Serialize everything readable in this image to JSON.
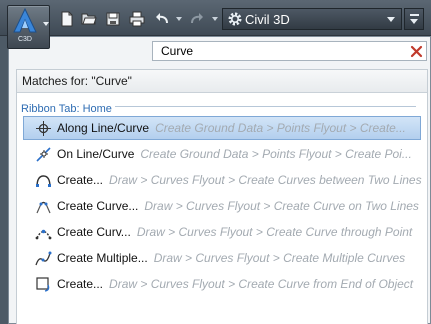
{
  "app": {
    "label": "C3D"
  },
  "workspace": {
    "label": "Civil 3D"
  },
  "search": {
    "value": "Curve"
  },
  "results": {
    "header": "Matches for: \"Curve\"",
    "group_label": "Ribbon Tab: Home",
    "items": [
      {
        "name": "Along Line/Curve",
        "path": "Create Ground Data > Points Flyout > Create...",
        "icon": "point-along-curve-icon",
        "selected": true
      },
      {
        "name": "On Line/Curve",
        "path": "Create Ground Data > Points Flyout > Create Poi...",
        "icon": "point-on-curve-icon"
      },
      {
        "name": "Create...",
        "path": "Draw > Curves Flyout > Create Curves between Two Lines",
        "icon": "curve-between-lines-icon"
      },
      {
        "name": "Create Curve...",
        "path": "Draw > Curves Flyout > Create Curve on Two Lines",
        "icon": "curve-on-two-lines-icon"
      },
      {
        "name": "Create Curv...",
        "path": "Draw > Curves Flyout > Create Curve through Point",
        "icon": "curve-through-point-icon"
      },
      {
        "name": "Create Multiple...",
        "path": "Draw > Curves Flyout > Create Multiple Curves",
        "icon": "multiple-curves-icon"
      },
      {
        "name": "Create...",
        "path": "Draw > Curves Flyout > Create Curve from End of Object",
        "icon": "curve-from-end-icon"
      }
    ]
  }
}
